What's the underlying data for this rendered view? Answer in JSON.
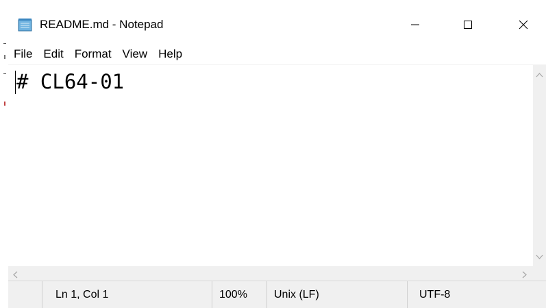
{
  "window": {
    "title": "README.md - Notepad",
    "icon": "notepad-icon"
  },
  "title_controls": {
    "minimize": "minimize-icon",
    "maximize": "maximize-icon",
    "close": "close-icon"
  },
  "menu": {
    "items": [
      {
        "label": "File"
      },
      {
        "label": "Edit"
      },
      {
        "label": "Format"
      },
      {
        "label": "View"
      },
      {
        "label": "Help"
      }
    ]
  },
  "editor": {
    "content": "# CL64-01"
  },
  "status": {
    "position": "Ln 1, Col 1",
    "zoom": "100%",
    "line_ending": "Unix (LF)",
    "encoding": "UTF-8"
  },
  "colors": {
    "window_bg": "#ffffff",
    "chrome_bg": "#f0f0f0",
    "text": "#000000"
  }
}
